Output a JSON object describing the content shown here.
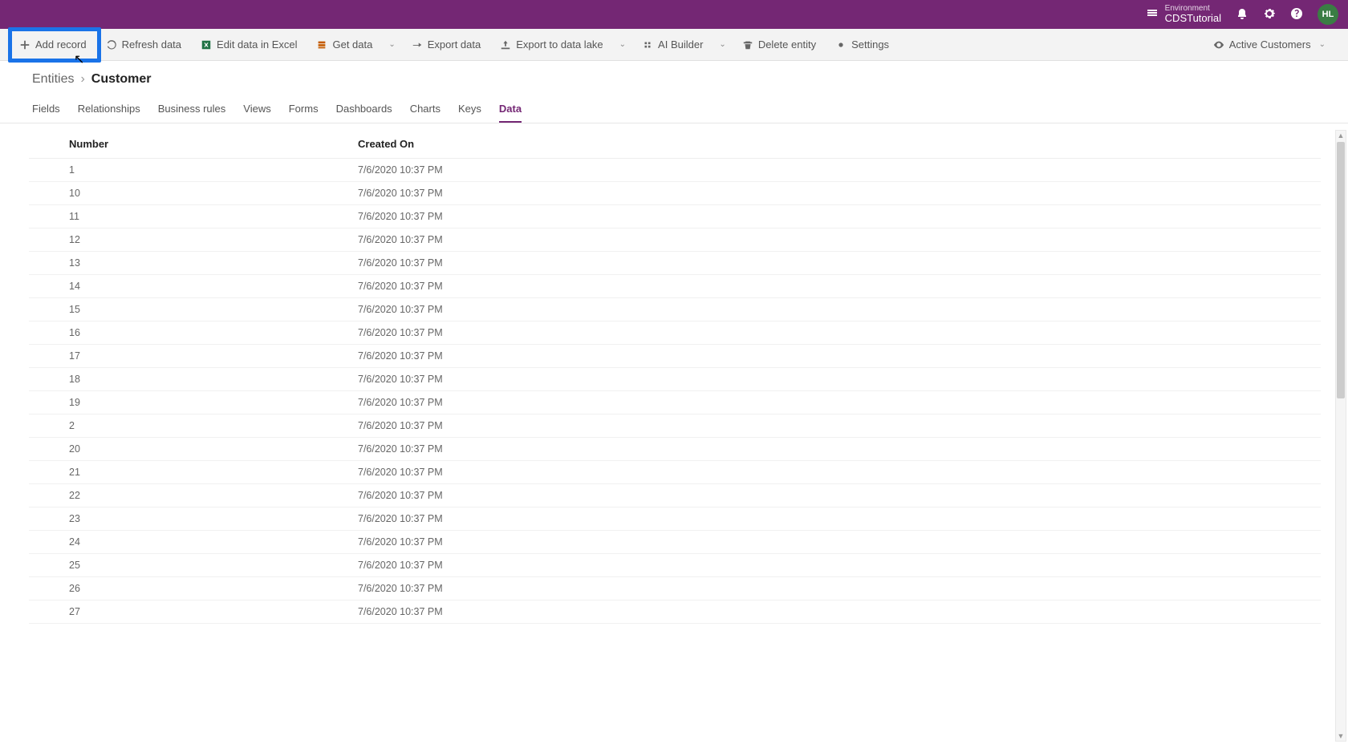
{
  "header": {
    "env_label": "Environment",
    "env_name": "CDSTutorial",
    "avatar": "HL"
  },
  "commands": {
    "add_record": "Add record",
    "refresh": "Refresh data",
    "edit_excel": "Edit data in Excel",
    "get_data": "Get data",
    "export": "Export data",
    "export_lake": "Export to data lake",
    "ai_builder": "AI Builder",
    "delete": "Delete entity",
    "settings": "Settings",
    "view_selector": "Active Customers"
  },
  "breadcrumb": {
    "root": "Entities",
    "current": "Customer"
  },
  "tabs": [
    "Fields",
    "Relationships",
    "Business rules",
    "Views",
    "Forms",
    "Dashboards",
    "Charts",
    "Keys",
    "Data"
  ],
  "active_tab": "Data",
  "columns": {
    "number": "Number",
    "created": "Created On"
  },
  "rows": [
    {
      "n": "1",
      "d": "7/6/2020 10:37 PM"
    },
    {
      "n": "10",
      "d": "7/6/2020 10:37 PM"
    },
    {
      "n": "11",
      "d": "7/6/2020 10:37 PM"
    },
    {
      "n": "12",
      "d": "7/6/2020 10:37 PM"
    },
    {
      "n": "13",
      "d": "7/6/2020 10:37 PM"
    },
    {
      "n": "14",
      "d": "7/6/2020 10:37 PM"
    },
    {
      "n": "15",
      "d": "7/6/2020 10:37 PM"
    },
    {
      "n": "16",
      "d": "7/6/2020 10:37 PM"
    },
    {
      "n": "17",
      "d": "7/6/2020 10:37 PM"
    },
    {
      "n": "18",
      "d": "7/6/2020 10:37 PM"
    },
    {
      "n": "19",
      "d": "7/6/2020 10:37 PM"
    },
    {
      "n": "2",
      "d": "7/6/2020 10:37 PM"
    },
    {
      "n": "20",
      "d": "7/6/2020 10:37 PM"
    },
    {
      "n": "21",
      "d": "7/6/2020 10:37 PM"
    },
    {
      "n": "22",
      "d": "7/6/2020 10:37 PM"
    },
    {
      "n": "23",
      "d": "7/6/2020 10:37 PM"
    },
    {
      "n": "24",
      "d": "7/6/2020 10:37 PM"
    },
    {
      "n": "25",
      "d": "7/6/2020 10:37 PM"
    },
    {
      "n": "26",
      "d": "7/6/2020 10:37 PM"
    },
    {
      "n": "27",
      "d": "7/6/2020 10:37 PM"
    }
  ]
}
